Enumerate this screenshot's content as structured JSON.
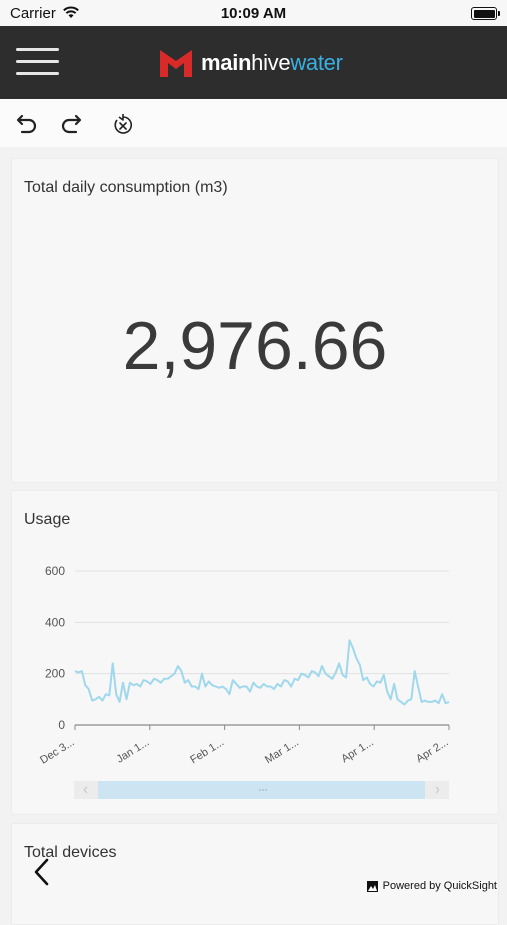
{
  "status_bar": {
    "carrier": "Carrier",
    "time": "10:09 AM"
  },
  "header": {
    "logo": {
      "part1": "main",
      "part2": "hive",
      "part3": "water"
    },
    "colors": {
      "background": "#2d2d2d",
      "logo_red": "#d92a2a",
      "logo_blue": "#3ab0e2"
    }
  },
  "toolbar": {
    "icons": [
      "undo-icon",
      "redo-icon",
      "reset-icon"
    ]
  },
  "kpi_card": {
    "title": "Total daily consumption (m3)",
    "value": "2,976.66"
  },
  "usage_card": {
    "title": "Usage"
  },
  "chart_data": {
    "type": "line",
    "title": "Usage",
    "ylim": [
      0,
      600
    ],
    "yticks": [
      "0",
      "200",
      "400",
      "600"
    ],
    "xticks": [
      "Dec 3...",
      "Jan 1...",
      "Feb 1...",
      "Mar 1...",
      "Apr 1...",
      "Apr 2..."
    ],
    "grid": true,
    "color": "#9fd8ec",
    "series": [
      {
        "values": [
          210,
          205,
          210,
          155,
          140,
          95,
          100,
          110,
          95,
          120,
          115,
          240,
          120,
          90,
          165,
          100,
          165,
          155,
          160,
          150,
          175,
          170,
          160,
          180,
          175,
          165,
          180,
          180,
          190,
          200,
          230,
          210,
          165,
          175,
          150,
          150,
          140,
          200,
          150,
          170,
          155,
          150,
          145,
          150,
          140,
          120,
          175,
          160,
          145,
          150,
          150,
          130,
          165,
          150,
          145,
          160,
          150,
          150,
          140,
          160,
          150,
          175,
          170,
          150,
          180,
          175,
          200,
          195,
          185,
          210,
          205,
          190,
          230,
          200,
          190,
          180,
          205,
          240,
          195,
          185,
          330,
          300,
          260,
          235,
          175,
          185,
          160,
          150,
          170,
          165,
          195,
          130,
          100,
          160,
          100,
          90,
          80,
          95,
          100,
          210,
          150,
          90,
          95,
          90,
          90,
          95,
          85,
          120,
          85,
          90
        ]
      }
    ]
  },
  "devices_card": {
    "title": "Total devices"
  },
  "footer": {
    "powered_by": "Powered by QuickSight"
  }
}
